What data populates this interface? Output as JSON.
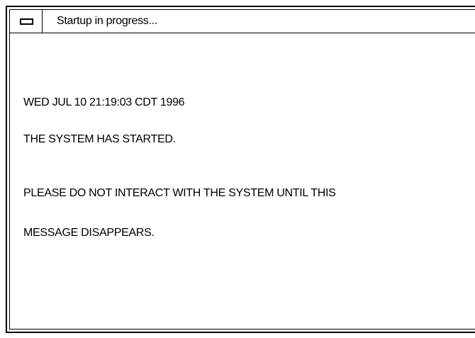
{
  "window": {
    "title": "Startup in progress...",
    "menu_icon": "window-menu-icon"
  },
  "message": {
    "timestamp": "WED JUL 10 21:19:03 CDT 1996",
    "status": "THE SYSTEM HAS STARTED.",
    "warning_line1": "PLEASE DO NOT INTERACT WITH THE SYSTEM UNTIL THIS",
    "warning_line2": "MESSAGE DISAPPEARS."
  }
}
